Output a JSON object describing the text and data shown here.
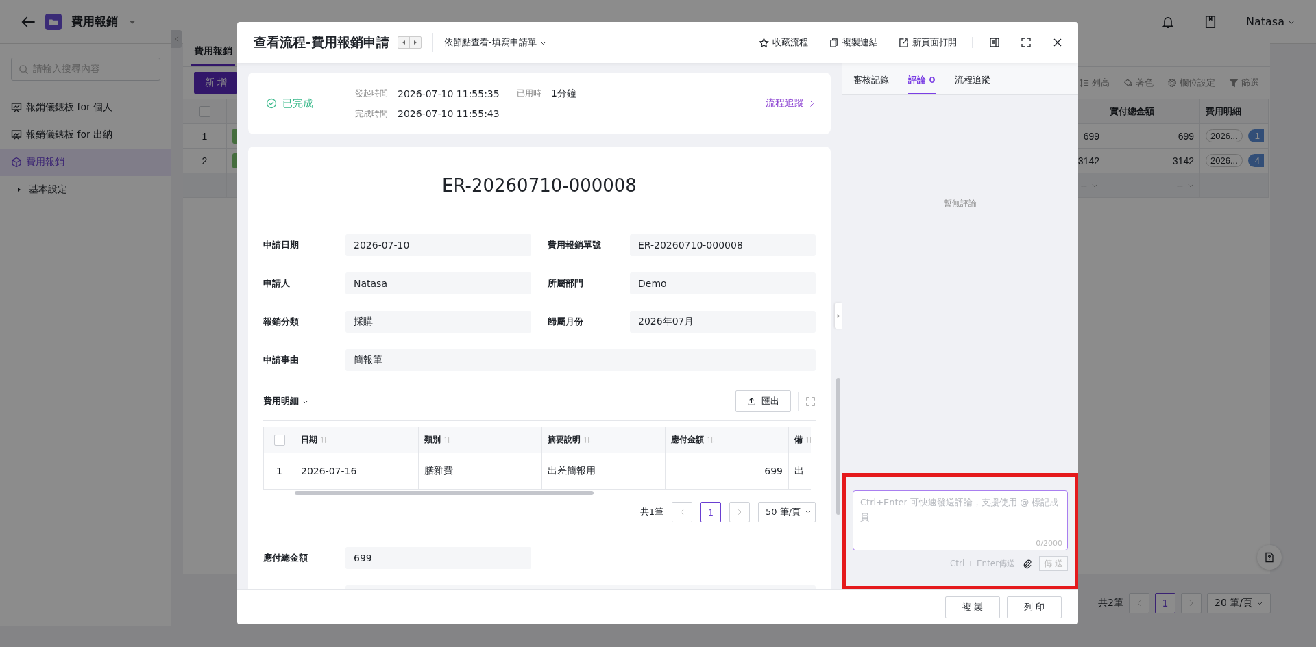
{
  "app_header": {
    "title": "費用報銷",
    "user": "Natasa"
  },
  "sidebar": {
    "search_placeholder": "請輸入搜尋內容",
    "items": [
      {
        "label": "報銷儀錶板 for 個人",
        "kind": "dashboard",
        "selected": false
      },
      {
        "label": "報銷儀錶板 for 出納",
        "kind": "dashboard",
        "selected": false
      },
      {
        "label": "費用報銷",
        "kind": "form",
        "selected": true
      },
      {
        "label": "基本設定",
        "kind": "group",
        "selected": false,
        "expanded": false
      }
    ]
  },
  "main": {
    "tabs": [
      {
        "label": "費用報銷",
        "selected": true
      }
    ],
    "add_button": "新 增",
    "toolbar": [
      {
        "label": "列高",
        "kind": "row-height"
      },
      {
        "label": "著色",
        "kind": "paint"
      },
      {
        "label": "欄位設定",
        "kind": "gear"
      },
      {
        "label": "篩選",
        "kind": "filter"
      }
    ],
    "table": {
      "select_all_checked": false,
      "columns": [
        "",
        "實付總金額",
        "費用明細"
      ],
      "rows": [
        {
          "index": "1",
          "cells": [
            "699",
            "699",
            "2026..."
          ],
          "count": "1"
        },
        {
          "index": "2",
          "cells": [
            "3142",
            "3142",
            "2026..."
          ],
          "count": "4"
        }
      ],
      "summary": [
        "--",
        "--"
      ]
    },
    "pagination": {
      "total": "共2筆",
      "page": "1",
      "page_size": "20 筆/頁"
    }
  },
  "dialog": {
    "title": "查看流程-費用報銷申請",
    "view_mode": "依節點查看-填寫申請單",
    "actions": [
      {
        "label": "收藏流程",
        "kind": "star"
      },
      {
        "label": "複製連結",
        "kind": "copy"
      },
      {
        "label": "新頁面打開",
        "kind": "open"
      }
    ],
    "status": {
      "label": "已完成",
      "fields": [
        {
          "label": "發起時間",
          "value": "2026-07-10 11:55:35"
        },
        {
          "label": "已用時",
          "value": "1分鐘"
        },
        {
          "label": "完成時間",
          "value": "2026-07-10 11:55:43"
        }
      ],
      "trace_link": "流程追蹤"
    },
    "form": {
      "title": "ER-20260710-000008",
      "fields": [
        {
          "label": "申請日期",
          "value": "2026-07-10",
          "wide": false
        },
        {
          "label": "費用報銷單號",
          "value": "ER-20260710-000008",
          "wide": false
        },
        {
          "label": "申請人",
          "value": "Natasa",
          "wide": false
        },
        {
          "label": "所屬部門",
          "value": "Demo",
          "wide": false
        },
        {
          "label": "報銷分類",
          "value": "採購",
          "wide": false
        },
        {
          "label": "歸屬月份",
          "value": "2026年07月",
          "wide": false
        },
        {
          "label": "申請事由",
          "value": "簡報筆",
          "wide": true
        }
      ],
      "detail": {
        "title": "費用明細",
        "export": "匯出",
        "select_all_checked": false,
        "columns": [
          {
            "label": "日期",
            "kind": "text"
          },
          {
            "label": "類別",
            "kind": "text"
          },
          {
            "label": "摘要說明",
            "kind": "text"
          },
          {
            "label": "應付金額",
            "kind": "number"
          },
          {
            "label": "備",
            "kind": "text"
          }
        ],
        "rows": [
          {
            "index": "1",
            "cells": [
              "2026-07-16",
              "膳雜費",
              "出差簡報用",
              "699",
              "出"
            ]
          }
        ],
        "total": "共1筆",
        "page": "1",
        "page_size": "50 筆/頁"
      },
      "summary_fields": [
        {
          "label": "應付總金額",
          "value": "699",
          "wide": false
        },
        {
          "wide": true
        }
      ]
    },
    "side": {
      "tabs": [
        {
          "label": "審核記錄",
          "selected": false
        },
        {
          "label": "評論 0",
          "selected": true
        },
        {
          "label": "流程追蹤",
          "selected": false
        }
      ],
      "empty_text": "暫無評論",
      "composer": {
        "placeholder": "Ctrl+Enter 可快速發送評論，支援使用 @ 標記成員",
        "counter": "0/2000",
        "hint": "Ctrl + Enter傳送",
        "send": "傳 送",
        "send_disabled": true,
        "highlighted": true
      }
    },
    "footer_buttons": [
      "複 製",
      "列 印"
    ]
  }
}
